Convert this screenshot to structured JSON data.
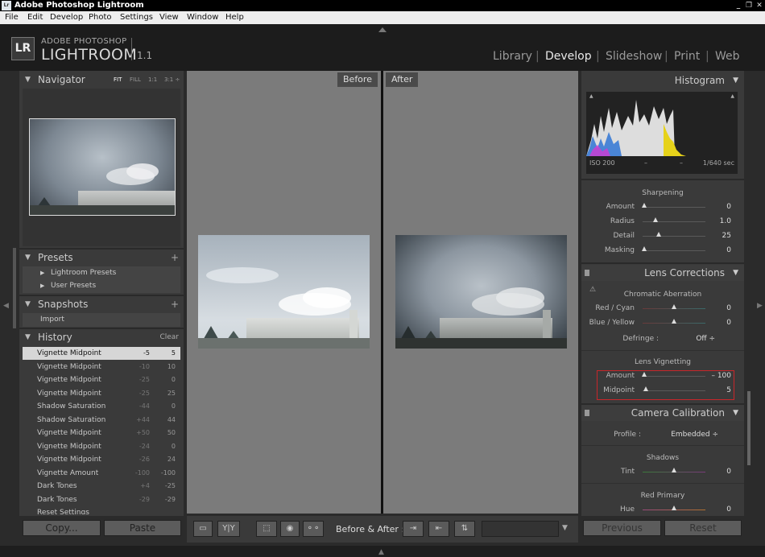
{
  "window": {
    "title": "Adobe Photoshop Lightroom",
    "app_icon": "Lr",
    "controls": [
      "_",
      "❐",
      "✕"
    ]
  },
  "menu": [
    "File",
    "Edit",
    "Develop",
    "Photo",
    "Settings",
    "View",
    "Window",
    "Help"
  ],
  "logo": {
    "icon": "LR",
    "top": "ADOBE PHOTOSHOP",
    "main": "LIGHTROOM",
    "version": "1.1"
  },
  "modules": [
    {
      "label": "Library",
      "active": false
    },
    {
      "label": "Develop",
      "active": true
    },
    {
      "label": "Slideshow",
      "active": false
    },
    {
      "label": "Print",
      "active": false
    },
    {
      "label": "Web",
      "active": false
    }
  ],
  "left": {
    "navigator": {
      "title": "Navigator",
      "zoom": [
        "FIT",
        "FILL",
        "1:1",
        "3:1 ÷"
      ]
    },
    "presets": {
      "title": "Presets",
      "add": "+",
      "items": [
        "Lightroom Presets",
        "User Presets"
      ]
    },
    "snapshots": {
      "title": "Snapshots",
      "add": "+",
      "items": [
        "Import"
      ]
    },
    "history": {
      "title": "History",
      "clear": "Clear",
      "items": [
        {
          "name": "Vignette Midpoint",
          "a": "-5",
          "b": "5",
          "selected": true
        },
        {
          "name": "Vignette Midpoint",
          "a": "-10",
          "b": "10"
        },
        {
          "name": "Vignette Midpoint",
          "a": "-25",
          "b": "0"
        },
        {
          "name": "Vignette Midpoint",
          "a": "-25",
          "b": "25"
        },
        {
          "name": "Shadow Saturation",
          "a": "-44",
          "b": "0"
        },
        {
          "name": "Shadow Saturation",
          "a": "+44",
          "b": "44"
        },
        {
          "name": "Vignette Midpoint",
          "a": "+50",
          "b": "50"
        },
        {
          "name": "Vignette Midpoint",
          "a": "-24",
          "b": "0"
        },
        {
          "name": "Vignette Midpoint",
          "a": "-26",
          "b": "24"
        },
        {
          "name": "Vignette Amount",
          "a": "-100",
          "b": "-100"
        },
        {
          "name": "Dark Tones",
          "a": "+4",
          "b": "-25"
        },
        {
          "name": "Dark Tones",
          "a": "-29",
          "b": "-29"
        },
        {
          "name": "Reset Settings",
          "a": "",
          "b": ""
        }
      ]
    },
    "copy_label": "Copy...",
    "paste_label": "Paste"
  },
  "center": {
    "before_label": "Before",
    "after_label": "After"
  },
  "toolbar": {
    "before_after_label": "Before & After :",
    "yy_label": "Y|Y"
  },
  "right": {
    "histogram": {
      "title": "Histogram",
      "iso": "ISO 200",
      "dash1": "–",
      "dash2": "–",
      "shutter": "1/640 sec"
    },
    "sharpening": {
      "title": "Sharpening",
      "rows": [
        {
          "label": "Amount",
          "value": "0",
          "pos": 0.02
        },
        {
          "label": "Radius",
          "value": "1.0",
          "pos": 0.2
        },
        {
          "label": "Detail",
          "value": "25",
          "pos": 0.25
        },
        {
          "label": "Masking",
          "value": "0",
          "pos": 0.02
        }
      ]
    },
    "lens": {
      "title": "Lens Corrections",
      "ca_title": "Chromatic Aberration",
      "ca_rows": [
        {
          "label": "Red / Cyan",
          "value": "0",
          "pos": 0.5
        },
        {
          "label": "Blue / Yellow",
          "value": "0",
          "pos": 0.5
        }
      ],
      "defringe_label": "Defringe :",
      "defringe_value": "Off ÷",
      "vig_title": "Lens Vignetting",
      "vig_rows": [
        {
          "label": "Amount",
          "value": "– 100",
          "pos": 0.02
        },
        {
          "label": "Midpoint",
          "value": "5",
          "pos": 0.05
        }
      ],
      "highlight_color": "#c8262a"
    },
    "calibration": {
      "title": "Camera Calibration",
      "profile_label": "Profile :",
      "profile_value": "Embedded ÷",
      "shadows_title": "Shadows",
      "tint": {
        "label": "Tint",
        "value": "0",
        "pos": 0.5
      },
      "red_title": "Red Primary",
      "hue": {
        "label": "Hue",
        "value": "0",
        "pos": 0.5
      }
    },
    "previous_label": "Previous",
    "reset_label": "Reset"
  }
}
